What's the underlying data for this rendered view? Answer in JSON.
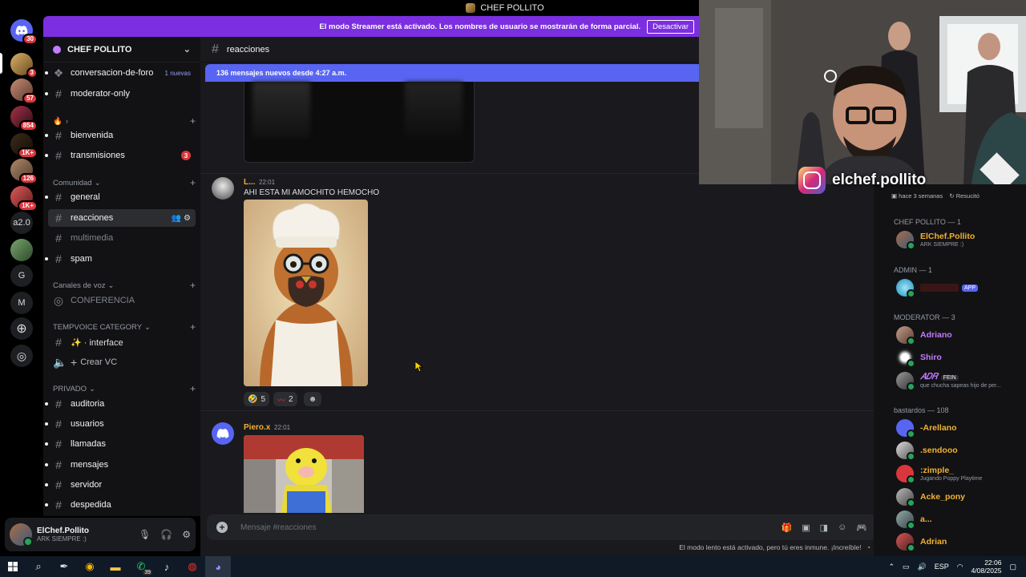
{
  "window": {
    "title": "CHEF POLLITO"
  },
  "rail": {
    "servers": [
      {
        "label": "",
        "badge": "30",
        "name": "discord-home"
      },
      {
        "label": "",
        "badge": "3",
        "name": "server-chef"
      },
      {
        "label": "",
        "badge": "57",
        "name": "server-2"
      },
      {
        "label": "",
        "badge": "854",
        "name": "server-3"
      },
      {
        "label": "",
        "badge": "1K+",
        "name": "server-4"
      },
      {
        "label": "",
        "badge": "126",
        "name": "server-5"
      },
      {
        "label": "",
        "badge": "1K+",
        "name": "server-6"
      },
      {
        "label": "a2.0",
        "badge": "",
        "name": "server-a20"
      },
      {
        "label": "",
        "badge": "",
        "name": "server-8"
      },
      {
        "label": "G",
        "badge": "",
        "name": "server-g"
      },
      {
        "label": "M",
        "badge": "",
        "name": "server-m"
      }
    ]
  },
  "streamer_banner": {
    "text": "El modo Streamer está activado. Los nombres de usuario se mostrarán de forma parcial.",
    "button": "Desactivar"
  },
  "server": {
    "name": "CHEF POLLITO"
  },
  "channels": {
    "top": [
      {
        "name": "conversacion-de-foro",
        "extra": "1 nuevas"
      },
      {
        "name": "moderator-only"
      }
    ],
    "cat1_label": "›",
    "cat1": [
      {
        "name": "bienvenida"
      },
      {
        "name": "transmisiones",
        "count": "3"
      }
    ],
    "comunidad_label": "Comunidad",
    "comunidad": [
      {
        "name": "general"
      },
      {
        "name": "reacciones"
      },
      {
        "name": "multimedia"
      },
      {
        "name": "spam"
      }
    ],
    "voz_label": "Canales de voz",
    "voz": [
      {
        "name": "CONFERENCIA"
      }
    ],
    "temp_label": "TEMPVOICE CATEGORY",
    "temp": [
      {
        "name": "✨ · interface"
      },
      {
        "name": "Crear VC"
      }
    ],
    "priv_label": "PRIVADO",
    "priv": [
      {
        "name": "auditoria"
      },
      {
        "name": "usuarios"
      },
      {
        "name": "llamadas"
      },
      {
        "name": "mensajes"
      },
      {
        "name": "servidor"
      },
      {
        "name": "despedida"
      }
    ]
  },
  "user": {
    "name": "ElChef.Pollito",
    "status": "ARK SIEMPRE :)"
  },
  "chat": {
    "channel": "reacciones",
    "new_messages": "136 mensajes nuevos desde 4:27 a.m.",
    "messages": [
      {
        "author": "L...",
        "time": "22:01",
        "text": "AHI ESTA MI AMOCHITO HEMOCHO",
        "author_color": "#f0b232"
      },
      {
        "author": "Piero.x",
        "time": "22:01",
        "text": "",
        "author_color": "#f0b232"
      }
    ],
    "reactions": [
      {
        "emoji": "🤣",
        "count": "5"
      },
      {
        "emoji": "〰",
        "count": "2"
      }
    ],
    "placeholder": "Mensaje #reacciones",
    "slowmode": "El modo lento está activado, pero tú eres inmune. ¡Increíble!"
  },
  "members": {
    "header_fragment": "hace 3 semanas",
    "header_fragment2": "Resucitó",
    "groups": [
      {
        "label": "CHEF POLLITO — 1",
        "members": [
          {
            "name": "ElChef.Pollito",
            "status": "ARK SIEMPRE :)",
            "color": "#f0b232"
          }
        ]
      },
      {
        "label": "ADMIN — 1",
        "members": [
          {
            "name": "",
            "status": "",
            "color": "#da373c",
            "tag": "APP"
          }
        ]
      },
      {
        "label": "MODERATOR — 3",
        "members": [
          {
            "name": "Adriano",
            "status": "",
            "color": "#c27cff"
          },
          {
            "name": "Shiro",
            "status": "",
            "color": "#c27cff"
          },
          {
            "name": "𝐴𝐷𝑅",
            "status": "que chucha sapeas hijo de per...",
            "color": "#c27cff",
            "fein": "FEIN"
          }
        ]
      },
      {
        "label": "bastardos — 108",
        "members": [
          {
            "name": "-Arellano",
            "status": "",
            "color": "#f0b232"
          },
          {
            "name": ".sendooo",
            "status": "",
            "color": "#f0b232"
          },
          {
            "name": ":zimple_",
            "status": "Jugando Poppy Playtime",
            "color": "#f0b232"
          },
          {
            "name": "Acke_pony",
            "status": "",
            "color": "#f0b232"
          },
          {
            "name": "a...",
            "status": "",
            "color": "#f0b232"
          },
          {
            "name": "Adrian",
            "status": "",
            "color": "#f0b232"
          }
        ]
      }
    ]
  },
  "cam": {
    "handle": "elchef.pollito"
  },
  "taskbar": {
    "badge_whatsapp": "39",
    "lang": "ESP",
    "time": "22:06",
    "date": "4/08/2025"
  }
}
